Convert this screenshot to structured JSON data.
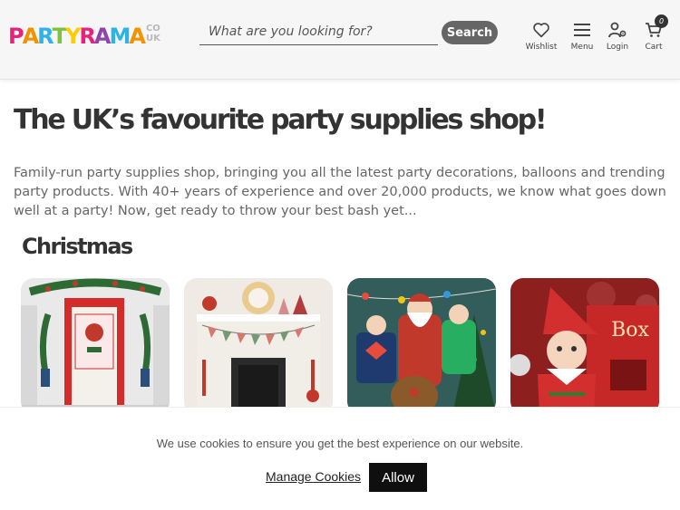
{
  "header": {
    "logo": {
      "letters": [
        "P",
        "A",
        "R",
        "T",
        "Y",
        "R",
        "A",
        "M",
        "A"
      ],
      "letter_colors": [
        "#e8217a",
        "#f39200",
        "#2eb3e6",
        "#7cc142",
        "#ffcc00",
        "#e8217a",
        "#8e44ad",
        "#2eb3e6",
        "#f39200"
      ],
      "tld_top": "CO",
      "tld_bottom": "UK"
    },
    "search": {
      "placeholder": "What are you looking for?",
      "value": "",
      "button_label": "Search"
    },
    "nav": {
      "wishlist": {
        "label": "Wishlist",
        "icon": "heart-icon"
      },
      "menu": {
        "label": "Menu",
        "icon": "hamburger-icon"
      },
      "login": {
        "label": "Login",
        "icon": "user-gear-icon"
      },
      "cart": {
        "label": "Cart",
        "icon": "cart-icon",
        "count": "0"
      }
    }
  },
  "main": {
    "headline": "The UK’s favourite party supplies shop!",
    "intro": "Family-run party supplies shop, bringing you all the latest party decorations, balloons and trending party products. With 40+ years of experience and over 20,000 products, we know what goes down well at a party! Now, get ready to throw your best bash yet...",
    "section_title": "Christmas",
    "cards": [
      {
        "name": "christmas-door-decorations"
      },
      {
        "name": "merry-christmas-bunting"
      },
      {
        "name": "christmas-party-costumes"
      },
      {
        "name": "elf-on-the-shelf"
      }
    ],
    "card4_box_text": "Box"
  },
  "cookie_banner": {
    "message": "We use cookies to ensure you get the best experience on our website.",
    "manage_label": "Manage Cookies",
    "allow_label": "Allow"
  },
  "colors": {
    "header_bg": "#f6f6f6",
    "search_button": "#666666",
    "allow_button": "#0f0f0f",
    "text_dark": "#333333",
    "text_body": "#666666"
  }
}
